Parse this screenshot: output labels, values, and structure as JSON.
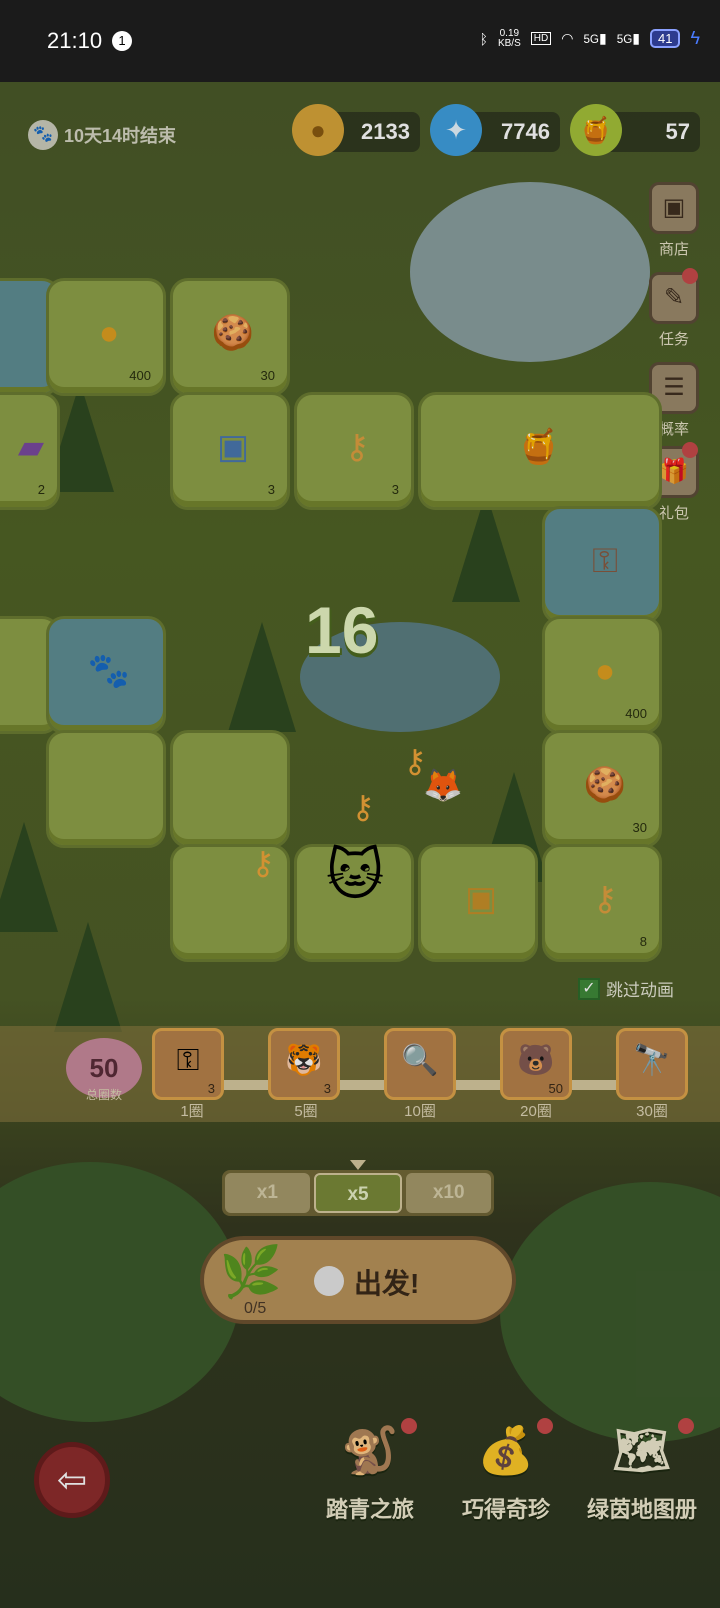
{
  "status_bar": {
    "time": "21:10",
    "notification_count": "1",
    "net_speed_value": "0.19",
    "net_speed_unit": "KB/S",
    "hd_label": "HD",
    "signal1": "5G",
    "signal2": "5G",
    "battery": "41"
  },
  "event_timer": "10天14时结束",
  "currencies": {
    "coins": "2133",
    "gems": "7746",
    "honey": "57"
  },
  "side_menu": [
    {
      "label": "商店",
      "icon": "shop-icon"
    },
    {
      "label": "任务",
      "icon": "task-icon"
    },
    {
      "label": "概率",
      "icon": "probability-icon"
    },
    {
      "label": "礼包",
      "icon": "gift-icon"
    }
  ],
  "board": {
    "tiles": [
      {
        "item": "coin",
        "count": "400"
      },
      {
        "item": "biscuit",
        "count": "30"
      },
      {
        "item": "chest-blue",
        "count": "3"
      },
      {
        "item": "key",
        "count": "3"
      },
      {
        "item": "chest-purple",
        "count": "2"
      },
      {
        "item": "coin",
        "count": "400"
      },
      {
        "item": "biscuit",
        "count": "30"
      },
      {
        "item": "chest-gold",
        "count": ""
      },
      {
        "item": "key",
        "count": "8"
      }
    ],
    "dice_roll": "16"
  },
  "skip_animation": {
    "label": "跳过动画",
    "checked": true
  },
  "progress": {
    "total_laps": "50",
    "total_laps_label": "总圈数",
    "milestones": [
      {
        "label": "1圈",
        "reward": "key",
        "count": "3"
      },
      {
        "label": "5圈",
        "reward": "cat-box",
        "count": "3"
      },
      {
        "label": "10圈",
        "reward": "magnifier",
        "count": ""
      },
      {
        "label": "20圈",
        "reward": "bear-card",
        "count": "50"
      },
      {
        "label": "30圈",
        "reward": "telescope",
        "count": ""
      }
    ]
  },
  "multipliers": [
    {
      "label": "x1",
      "active": false
    },
    {
      "label": "x5",
      "active": true
    },
    {
      "label": "x10",
      "active": false
    }
  ],
  "go_button": {
    "label": "出发!",
    "leaf_count": "0/5"
  },
  "bottom_nav": [
    {
      "label": "踏青之旅",
      "icon": "journey-icon"
    },
    {
      "label": "巧得奇珍",
      "icon": "treasure-icon"
    },
    {
      "label": "绿茵地图册",
      "icon": "map-album-icon"
    }
  ]
}
